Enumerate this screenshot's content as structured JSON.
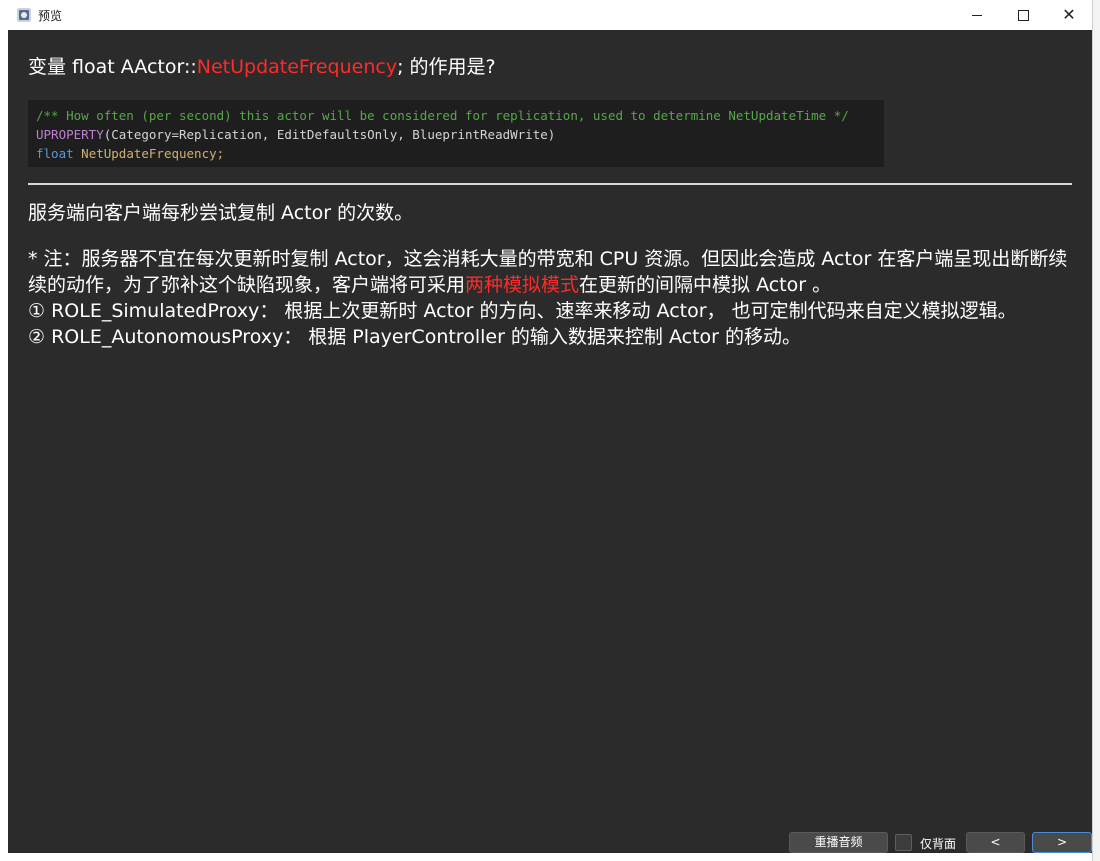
{
  "window": {
    "title": "预览",
    "minimize_icon": "minimize-icon",
    "maximize_icon": "maximize-icon",
    "close_icon": "close-icon"
  },
  "question": {
    "prefix": "变量 float AActor::",
    "highlight": "NetUpdateFrequency",
    "suffix": "; 的作用是?"
  },
  "code": {
    "line1": "/** How often (per second) this actor will be considered for replication, used to determine NetUpdateTime */",
    "line2_macro": "UPROPERTY",
    "line2_args": "(Category=Replication, EditDefaultsOnly, BlueprintReadWrite)",
    "line3_keyword": "float",
    "line3_ident": "NetUpdateFrequency;"
  },
  "answer": {
    "text": "服务端向客户端每秒尝试复制 Actor 的次数。",
    "note_part1": "* 注：服务器不宜在每次更新时复制 Actor，这会消耗大量的带宽和 CPU 资源。但因此会造成 Actor 在客户端呈现出断断续续的动作，为了弥补这个缺陷现象，客户端将可采用",
    "note_highlight": "两种模拟模式",
    "note_part2": "在更新的间隔中模拟 Actor 。",
    "item1": "① ROLE_SimulatedProxy： 根据上次更新时 Actor 的方向、速率来移动 Actor， 也可定制代码来自定义模拟逻辑。",
    "item2": "② ROLE_AutonomousProxy： 根据 PlayerController 的输入数据来控制 Actor 的移动。"
  },
  "footer": {
    "replay_label": "重播音频",
    "checkbox_label": "仅背面",
    "checkbox_checked": false,
    "prev_label": "<",
    "next_label": ">"
  },
  "colors": {
    "highlight": "#ff2a2a",
    "content_bg": "#2b2b2b",
    "code_bg": "#1e1e1e",
    "next_border": "#4a8bd6"
  }
}
